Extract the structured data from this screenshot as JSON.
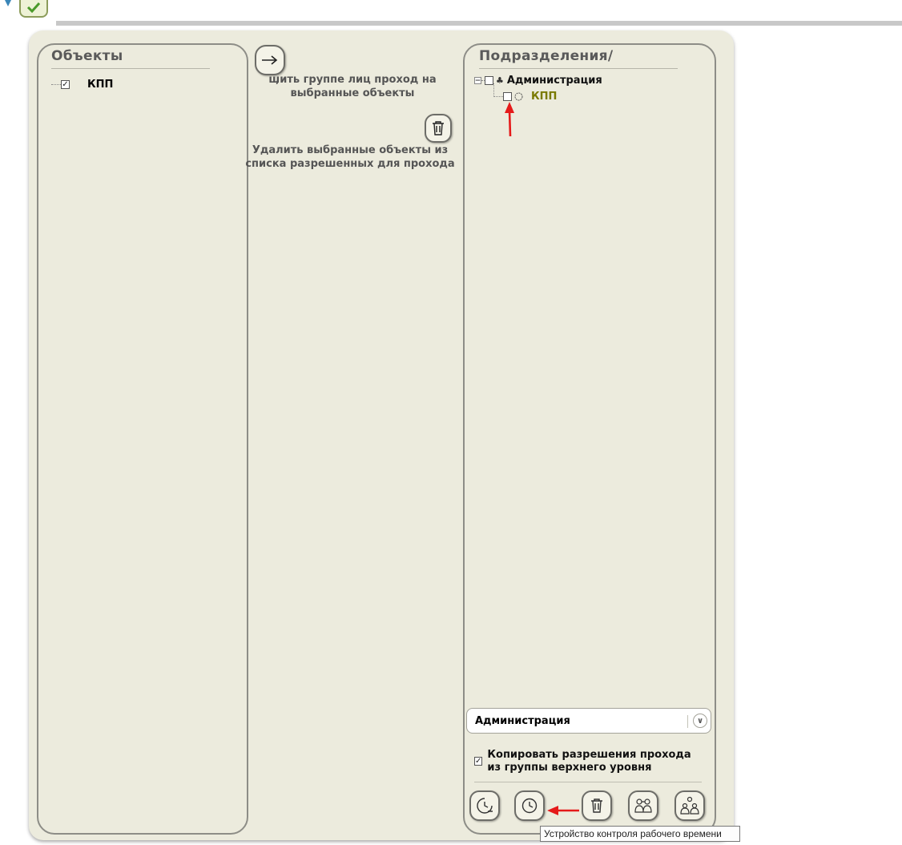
{
  "left_panel": {
    "title": "Объекты",
    "items": [
      {
        "label": "КПП",
        "checked": true
      }
    ]
  },
  "middle": {
    "grant_text": "шить группе лиц проход на выбранные объекты",
    "grant_text_prefix": ",",
    "delete_text": "Удалить выбранные объекты из списка разрешенных для прохода"
  },
  "right_panel": {
    "title": "Подразделения/",
    "tree": {
      "root": {
        "label": "Администрация",
        "checked": false,
        "icon": "group-icon",
        "expanded": true
      },
      "children": [
        {
          "label": "КПП",
          "checked": false,
          "icon": "clock-icon",
          "color": "#7a7a00"
        }
      ]
    },
    "department_select": {
      "value": "Администрация"
    },
    "copy_permissions": {
      "checked": true,
      "label": "Копировать разрешения прохода из группы верхнего уровня"
    },
    "toolbar": [
      "clock-minus-icon",
      "clock-icon",
      "trash-icon",
      "group-link-icon",
      "group-hierarchy-icon"
    ]
  },
  "tooltip": {
    "text": "Устройство контроля рабочего времени"
  },
  "colors": {
    "annotation_arrow": "#e51a1a",
    "panel_bg": "#ecebdd",
    "tree_child_text": "#7a7a00"
  }
}
